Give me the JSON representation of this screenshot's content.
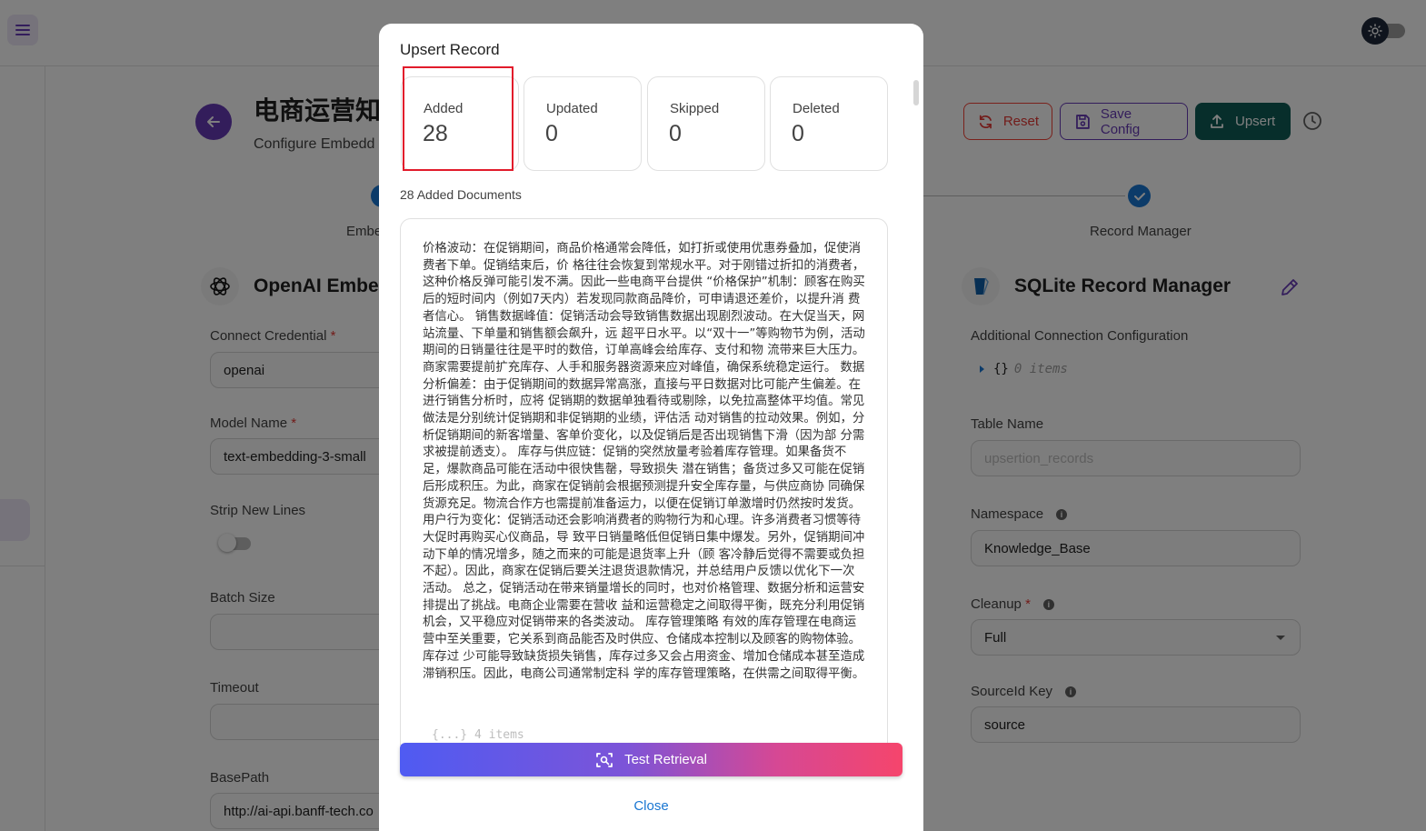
{
  "header": {
    "page_title": "电商运营知",
    "page_subtitle": "Configure Embedd",
    "reset_label": "Reset",
    "save_config_label": "Save Config",
    "upsert_label": "Upsert"
  },
  "stepper": {
    "left_label": "Embe",
    "right_label": "Record Manager"
  },
  "embeddings": {
    "title": "OpenAI Embedd",
    "credential_label": "Connect Credential",
    "credential_value": "openai",
    "model_label": "Model Name",
    "model_value": "text-embedding-3-small",
    "strip_label": "Strip New Lines",
    "batch_label": "Batch Size",
    "batch_value": "",
    "timeout_label": "Timeout",
    "timeout_value": "",
    "basepath_label": "BasePath",
    "basepath_value": "http://ai-api.banff-tech.co"
  },
  "record_manager": {
    "title": "SQLite Record Manager",
    "additional_label": "Additional Connection Configuration",
    "json_braces": "{}",
    "json_count": "0 items",
    "table_label": "Table Name",
    "table_placeholder": "upsertion_records",
    "namespace_label": "Namespace",
    "namespace_value": "Knowledge_Base",
    "cleanup_label": "Cleanup",
    "cleanup_value": "Full",
    "sourceid_label": "SourceId Key",
    "sourceid_value": "source",
    "required_mark": "*",
    "info_glyph": "i"
  },
  "dialog": {
    "title": "Upsert Record",
    "stats": [
      {
        "label": "Added",
        "value": "28"
      },
      {
        "label": "Updated",
        "value": "0"
      },
      {
        "label": "Skipped",
        "value": "0"
      },
      {
        "label": "Deleted",
        "value": "0"
      }
    ],
    "docs_count_label": "28 Added Documents",
    "document_text": "价格波动：在促销期间，商品价格通常会降低，如打折或使用优惠券叠加，促使消费者下单。促销结束后，价 格往往会恢复到常规水平。对于刚错过折扣的消费者，这种价格反弹可能引发不满。因此一些电商平台提供 “价格保护”机制：顾客在购买后的短时间内（例如7天内）若发现同款商品降价，可申请退还差价，以提升消 费者信心。 销售数据峰值：促销活动会导致销售数据出现剧烈波动。在大促当天，网站流量、下单量和销售额会飙升，远 超平日水平。以“双十一”等购物节为例，活动期间的日销量往往是平时的数倍，订单高峰会给库存、支付和物 流带来巨大压力。商家需要提前扩充库存、人手和服务器资源来应对峰值，确保系统稳定运行。 数据分析偏差：由于促销期间的数据异常高涨，直接与平日数据对比可能产生偏差。在进行销售分析时，应将 促销期的数据单独看待或剔除，以免拉高整体平均值。常见做法是分别统计促销期和非促销期的业绩，评估活 动对销售的拉动效果。例如，分析促销期间的新客增量、客单价变化，以及促销后是否出现销售下滑（因为部 分需求被提前透支）。 库存与供应链：促销的突然放量考验着库存管理。如果备货不足，爆款商品可能在活动中很快售罄，导致损失 潜在销售；备货过多又可能在促销后形成积压。为此，商家在促销前会根据预测提升安全库存量，与供应商协 同确保货源充足。物流合作方也需提前准备运力，以便在促销订单激增时仍然按时发货。 用户行为变化：促销活动还会影响消费者的购物行为和心理。许多消费者习惯等待大促时再购买心仪商品，导 致平日销量略低但促销日集中爆发。另外，促销期间冲动下单的情况增多，随之而来的可能是退货率上升（顾 客冷静后觉得不需要或负担不起）。因此，商家在促销后要关注退货退款情况，并总结用户反馈以优化下一次 活动。 总之，促销活动在带来销量增长的同时，也对价格管理、数据分析和运营安排提出了挑战。电商企业需要在营收 益和运营稳定之间取得平衡，既充分利用促销机会，又平稳应对促销带来的各类波动。 库存管理策略 有效的库存管理在电商运营中至关重要，它关系到商品能否及时供应、仓储成本控制以及顾客的购物体验。库存过 少可能导致缺货损失销售，库存过多又会占用资金、增加仓储成本甚至造成滞销积压。因此，电商公司通常制定科 学的库存管理策略，在供需之间取得平衡。",
    "doc_meta": "{...} 4 items",
    "test_retrieval_label": "Test Retrieval",
    "close_label": "Close"
  },
  "colors": {
    "accent": "#673ab7",
    "upsert_bg": "#0f5c57",
    "highlight": "#e21b2b",
    "link": "#1976d2"
  }
}
